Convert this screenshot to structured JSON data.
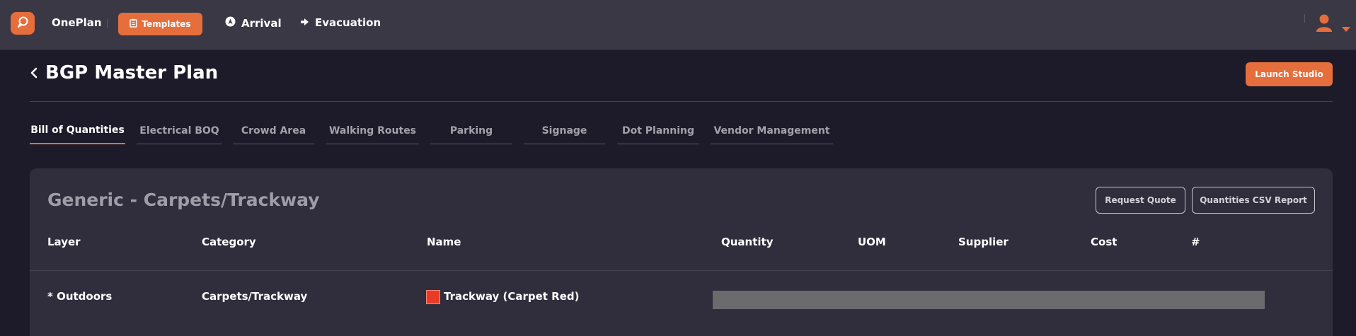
{
  "topbar": {
    "app_name": "OnePlan",
    "templates_label": "Templates",
    "nav": [
      {
        "label": "Arrival",
        "icon": "navigation-icon"
      },
      {
        "label": "Evacuation",
        "icon": "arrow-right-icon"
      }
    ],
    "logo_icon": "chat-bubble-icon",
    "avatar_icon": "user-icon"
  },
  "header": {
    "title": "BGP Master Plan",
    "launch_label": "Launch Studio"
  },
  "tabs": [
    {
      "label": "Bill of Quantities",
      "active": true
    },
    {
      "label": "Electrical BOQ"
    },
    {
      "label": "Crowd Area"
    },
    {
      "label": "Walking Routes"
    },
    {
      "label": "Parking"
    },
    {
      "label": "Signage"
    },
    {
      "label": "Dot Planning"
    },
    {
      "label": "Vendor Management"
    }
  ],
  "panel": {
    "title": "Generic - Carpets/Trackway",
    "request_quote_label": "Request Quote",
    "csv_report_label": "Quantities CSV Report",
    "columns": [
      "Layer",
      "Category",
      "Name",
      "Quantity",
      "UOM",
      "Supplier",
      "Cost",
      "#"
    ],
    "rows": [
      {
        "layer": "* Outdoors",
        "category": "Carpets/Trackway",
        "name": "Trackway (Carpet Red)",
        "swatch_color": "#e83a25"
      }
    ]
  },
  "colors": {
    "accent": "#e56e3c",
    "topbar": "#3b3845",
    "background": "#1d1b29",
    "panel": "#302e3c"
  }
}
